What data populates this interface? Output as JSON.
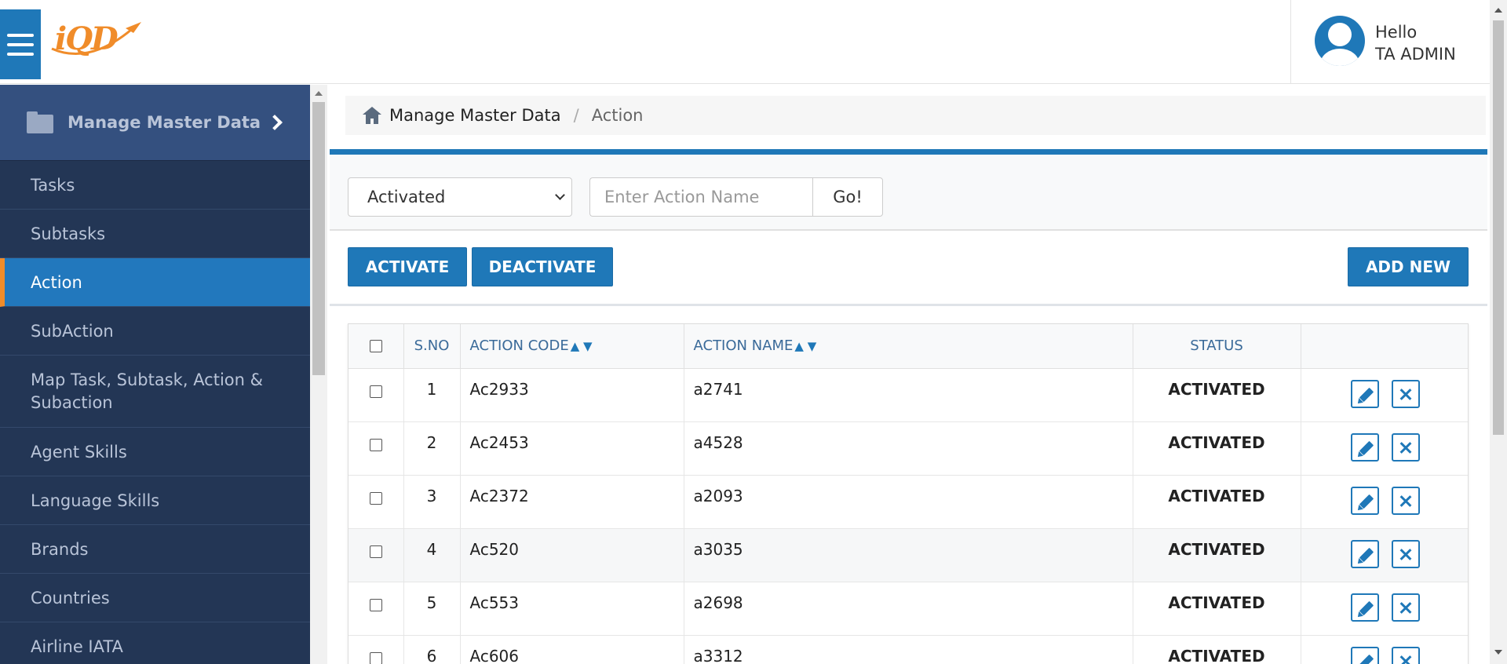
{
  "header": {
    "logo_text": "iQD",
    "greeting": "Hello",
    "username": "TA ADMIN"
  },
  "sidebar": {
    "section_title": "Manage Master Data",
    "items": [
      {
        "label": "Tasks",
        "active": false
      },
      {
        "label": "Subtasks",
        "active": false
      },
      {
        "label": "Action",
        "active": true
      },
      {
        "label": "SubAction",
        "active": false
      },
      {
        "label": "Map Task, Subtask, Action & Subaction",
        "active": false
      },
      {
        "label": "Agent Skills",
        "active": false
      },
      {
        "label": "Language Skills",
        "active": false
      },
      {
        "label": "Brands",
        "active": false
      },
      {
        "label": "Countries",
        "active": false
      },
      {
        "label": "Airline IATA",
        "active": false
      }
    ]
  },
  "breadcrumb": {
    "home": "Manage Master Data",
    "separator": "/",
    "current": "Action"
  },
  "filters": {
    "status_selected": "Activated",
    "search_placeholder": "Enter Action Name",
    "search_value": "",
    "go_label": "Go!"
  },
  "actions": {
    "activate_label": "ACTIVATE",
    "deactivate_label": "DEACTIVATE",
    "add_new_label": "ADD NEW"
  },
  "table": {
    "columns": {
      "sno": "S.NO",
      "action_code": "ACTION CODE",
      "action_name": "ACTION NAME",
      "status": "STATUS",
      "sort_arrows": "▲ ▼"
    },
    "rows": [
      {
        "sno": "1",
        "code": "Ac2933",
        "name": "a2741",
        "status": "ACTIVATED"
      },
      {
        "sno": "2",
        "code": "Ac2453",
        "name": "a4528",
        "status": "ACTIVATED"
      },
      {
        "sno": "3",
        "code": "Ac2372",
        "name": "a2093",
        "status": "ACTIVATED"
      },
      {
        "sno": "4",
        "code": "Ac520",
        "name": "a3035",
        "status": "ACTIVATED"
      },
      {
        "sno": "5",
        "code": "Ac553",
        "name": "a2698",
        "status": "ACTIVATED"
      },
      {
        "sno": "6",
        "code": "Ac606",
        "name": "a3312",
        "status": "ACTIVATED"
      }
    ]
  },
  "colors": {
    "primary": "#1f78b8",
    "sidebar_bg": "#233655",
    "sidebar_header": "#34507f",
    "accent": "#f08c2a"
  },
  "icons": [
    "menu-icon",
    "folder-icon",
    "chevron-right-icon",
    "home-icon",
    "user-avatar-icon",
    "chevron-down-icon",
    "edit-icon",
    "close-icon"
  ]
}
